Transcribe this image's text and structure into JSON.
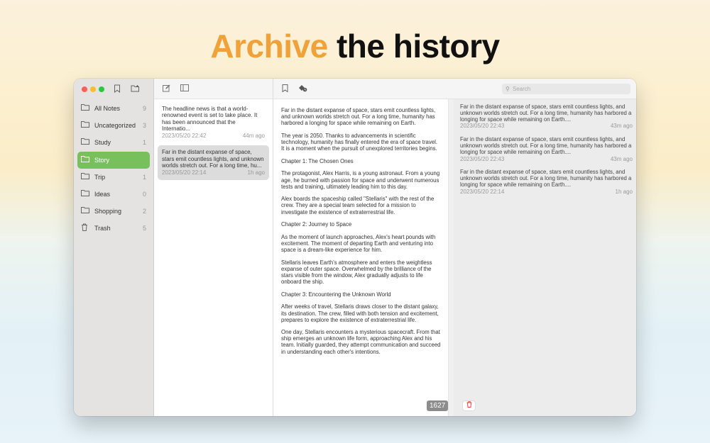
{
  "headline": {
    "accent": "Archive",
    "rest": "the history"
  },
  "sidebar": {
    "folders": [
      {
        "label": "All Notes",
        "count": "9"
      },
      {
        "label": "Uncategorized",
        "count": "3"
      },
      {
        "label": "Study",
        "count": "1"
      },
      {
        "label": "Story",
        "count": "",
        "active": true
      },
      {
        "label": "Trip",
        "count": "1"
      },
      {
        "label": "Ideas",
        "count": "0"
      },
      {
        "label": "Shopping",
        "count": "2"
      },
      {
        "label": "Trash",
        "count": "5"
      }
    ]
  },
  "notes": [
    {
      "preview": "The headline news is that a world-renowned event is set to take place. It has been announced that the Internatio...",
      "date": "2023/05/20 22:42",
      "age": "44m ago"
    },
    {
      "preview": "Far in the distant expanse of space, stars emit countless lights, and unknown worlds stretch out. For a long time, hu...",
      "date": "2023/05/20 22:14",
      "age": "1h ago"
    }
  ],
  "editor": {
    "paragraphs": [
      "Far in the distant expanse of space, stars emit countless lights, and unknown worlds stretch out. For a long time, humanity has harbored a longing for space while remaining on Earth.",
      "The year is 2050. Thanks to advancements in scientific technology, humanity has finally entered the era of space travel. It is a moment when the pursuit of unexplored territories begins.",
      "Chapter 1: The Chosen Ones",
      "The protagonist, Alex Harris, is a young astronaut. From a young age, he burned with passion for space and underwent numerous tests and training, ultimately leading him to this day.",
      "Alex boards the spaceship called \"Stellaris\" with the rest of the crew. They are a special team selected for a mission to investigate the existence of extraterrestrial life.",
      "Chapter 2: Journey to Space",
      "As the moment of launch approaches, Alex's heart pounds with excitement. The moment of departing Earth and venturing into space is a dream-like experience for him.",
      "Stellaris leaves Earth's atmosphere and enters the weightless expanse of outer space. Overwhelmed by the brilliance of the stars visible from the window, Alex gradually adjusts to life onboard the ship.",
      "Chapter 3: Encountering the Unknown World",
      "After weeks of travel, Stellaris draws closer to the distant galaxy, its destination. The crew, filled with both tension and excitement, prepares to explore the existence of extraterrestrial life.",
      "One day, Stellaris encounters a mysterious spacecraft. From that ship emerges an unknown life form, approaching Alex and his team. Initially guarded, they attempt communication and succeed in understanding each other's intentions."
    ],
    "word_count": "1627"
  },
  "search": {
    "placeholder": "Search"
  },
  "history": [
    {
      "preview": "Far in the distant expanse of space, stars emit countless lights, and unknown worlds stretch out. For a long time, humanity has harbored a longing for space while remaining on Earth....",
      "date": "2023/05/20 22:43",
      "age": "43m ago"
    },
    {
      "preview": "Far in the distant expanse of space, stars emit countless lights, and unknown worlds stretch out. For a long time, humanity has harbored a longing for space while remaining on Earth....",
      "date": "2023/05/20 22:43",
      "age": "43m ago"
    },
    {
      "preview": "Far in the distant expanse of space, stars emit countless lights, and unknown worlds stretch out. For a long time, humanity has harbored a longing for space while remaining on Earth....",
      "date": "2023/05/20 22:14",
      "age": "1h ago"
    }
  ],
  "icons": {
    "bookmark": "bookmark-icon",
    "new_folder": "new-folder-icon",
    "compose": "compose-icon",
    "sidebar_toggle": "sidebar-toggle-icon",
    "history": "history-icon",
    "trash": "trash-icon",
    "search": "search-icon"
  },
  "colors": {
    "accent": "#f0a23a",
    "active_folder": "#78c05b",
    "trash": "#e5453d"
  }
}
